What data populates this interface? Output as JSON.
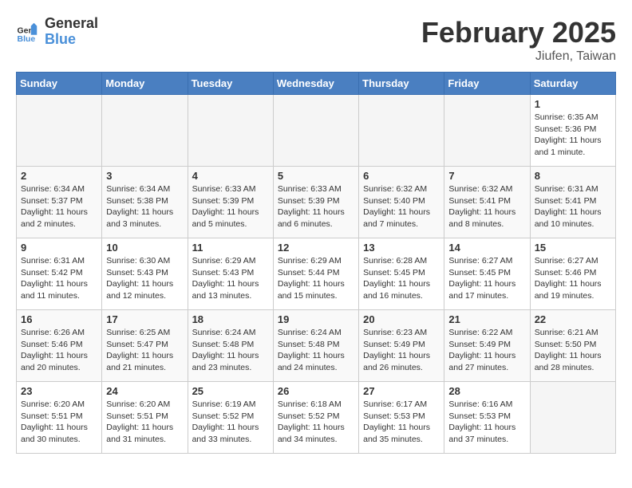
{
  "logo": {
    "general": "General",
    "blue": "Blue"
  },
  "title": "February 2025",
  "subtitle": "Jiufen, Taiwan",
  "days_of_week": [
    "Sunday",
    "Monday",
    "Tuesday",
    "Wednesday",
    "Thursday",
    "Friday",
    "Saturday"
  ],
  "weeks": [
    [
      {
        "day": "",
        "info": ""
      },
      {
        "day": "",
        "info": ""
      },
      {
        "day": "",
        "info": ""
      },
      {
        "day": "",
        "info": ""
      },
      {
        "day": "",
        "info": ""
      },
      {
        "day": "",
        "info": ""
      },
      {
        "day": "1",
        "info": "Sunrise: 6:35 AM\nSunset: 5:36 PM\nDaylight: 11 hours and 1 minute."
      }
    ],
    [
      {
        "day": "2",
        "info": "Sunrise: 6:34 AM\nSunset: 5:37 PM\nDaylight: 11 hours and 2 minutes."
      },
      {
        "day": "3",
        "info": "Sunrise: 6:34 AM\nSunset: 5:38 PM\nDaylight: 11 hours and 3 minutes."
      },
      {
        "day": "4",
        "info": "Sunrise: 6:33 AM\nSunset: 5:39 PM\nDaylight: 11 hours and 5 minutes."
      },
      {
        "day": "5",
        "info": "Sunrise: 6:33 AM\nSunset: 5:39 PM\nDaylight: 11 hours and 6 minutes."
      },
      {
        "day": "6",
        "info": "Sunrise: 6:32 AM\nSunset: 5:40 PM\nDaylight: 11 hours and 7 minutes."
      },
      {
        "day": "7",
        "info": "Sunrise: 6:32 AM\nSunset: 5:41 PM\nDaylight: 11 hours and 8 minutes."
      },
      {
        "day": "8",
        "info": "Sunrise: 6:31 AM\nSunset: 5:41 PM\nDaylight: 11 hours and 10 minutes."
      }
    ],
    [
      {
        "day": "9",
        "info": "Sunrise: 6:31 AM\nSunset: 5:42 PM\nDaylight: 11 hours and 11 minutes."
      },
      {
        "day": "10",
        "info": "Sunrise: 6:30 AM\nSunset: 5:43 PM\nDaylight: 11 hours and 12 minutes."
      },
      {
        "day": "11",
        "info": "Sunrise: 6:29 AM\nSunset: 5:43 PM\nDaylight: 11 hours and 13 minutes."
      },
      {
        "day": "12",
        "info": "Sunrise: 6:29 AM\nSunset: 5:44 PM\nDaylight: 11 hours and 15 minutes."
      },
      {
        "day": "13",
        "info": "Sunrise: 6:28 AM\nSunset: 5:45 PM\nDaylight: 11 hours and 16 minutes."
      },
      {
        "day": "14",
        "info": "Sunrise: 6:27 AM\nSunset: 5:45 PM\nDaylight: 11 hours and 17 minutes."
      },
      {
        "day": "15",
        "info": "Sunrise: 6:27 AM\nSunset: 5:46 PM\nDaylight: 11 hours and 19 minutes."
      }
    ],
    [
      {
        "day": "16",
        "info": "Sunrise: 6:26 AM\nSunset: 5:46 PM\nDaylight: 11 hours and 20 minutes."
      },
      {
        "day": "17",
        "info": "Sunrise: 6:25 AM\nSunset: 5:47 PM\nDaylight: 11 hours and 21 minutes."
      },
      {
        "day": "18",
        "info": "Sunrise: 6:24 AM\nSunset: 5:48 PM\nDaylight: 11 hours and 23 minutes."
      },
      {
        "day": "19",
        "info": "Sunrise: 6:24 AM\nSunset: 5:48 PM\nDaylight: 11 hours and 24 minutes."
      },
      {
        "day": "20",
        "info": "Sunrise: 6:23 AM\nSunset: 5:49 PM\nDaylight: 11 hours and 26 minutes."
      },
      {
        "day": "21",
        "info": "Sunrise: 6:22 AM\nSunset: 5:49 PM\nDaylight: 11 hours and 27 minutes."
      },
      {
        "day": "22",
        "info": "Sunrise: 6:21 AM\nSunset: 5:50 PM\nDaylight: 11 hours and 28 minutes."
      }
    ],
    [
      {
        "day": "23",
        "info": "Sunrise: 6:20 AM\nSunset: 5:51 PM\nDaylight: 11 hours and 30 minutes."
      },
      {
        "day": "24",
        "info": "Sunrise: 6:20 AM\nSunset: 5:51 PM\nDaylight: 11 hours and 31 minutes."
      },
      {
        "day": "25",
        "info": "Sunrise: 6:19 AM\nSunset: 5:52 PM\nDaylight: 11 hours and 33 minutes."
      },
      {
        "day": "26",
        "info": "Sunrise: 6:18 AM\nSunset: 5:52 PM\nDaylight: 11 hours and 34 minutes."
      },
      {
        "day": "27",
        "info": "Sunrise: 6:17 AM\nSunset: 5:53 PM\nDaylight: 11 hours and 35 minutes."
      },
      {
        "day": "28",
        "info": "Sunrise: 6:16 AM\nSunset: 5:53 PM\nDaylight: 11 hours and 37 minutes."
      },
      {
        "day": "",
        "info": ""
      }
    ]
  ]
}
